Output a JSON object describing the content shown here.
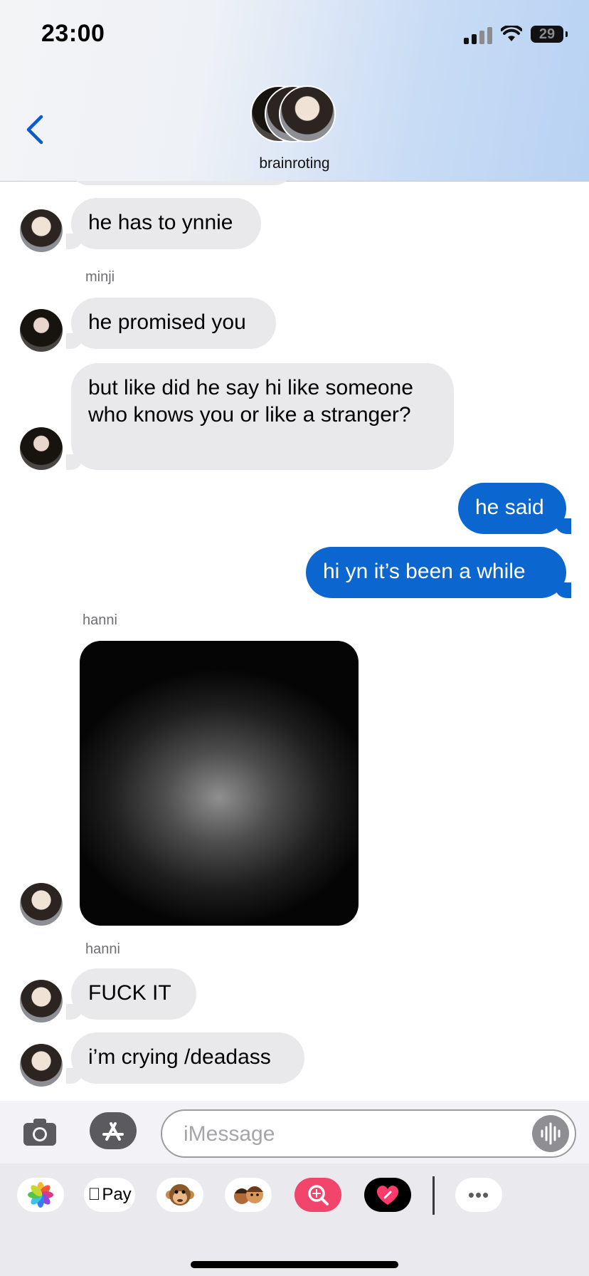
{
  "status_bar": {
    "time": "23:00",
    "battery": "29"
  },
  "header": {
    "group_name": "brainroting"
  },
  "messages": [
    {
      "text": "he has to ynnie"
    },
    {
      "sender": "minji"
    },
    {
      "text": "he promised you"
    },
    {
      "text": "but like did he say hi like someone who knows you or like a stranger?"
    },
    {
      "text": "he said"
    },
    {
      "text": "hi yn it’s been a while"
    },
    {
      "sender": "hanni"
    },
    {
      "sender": "hanni"
    },
    {
      "text": "FUCK IT"
    },
    {
      "text": "i’m crying /deadass"
    }
  ],
  "input": {
    "placeholder": "iMessage"
  },
  "apps": [
    "photos-icon",
    "apple-pay-icon",
    "monkey-memoji-icon",
    "memoji-stickers-icon",
    "image-search-icon",
    "digital-touch-icon",
    "more-icon"
  ],
  "apple_pay_label": "Pay",
  "more_label": "•••",
  "colors": {
    "outgoing_bubble": "#0b66cf",
    "incoming_bubble": "#e9e9eb"
  }
}
